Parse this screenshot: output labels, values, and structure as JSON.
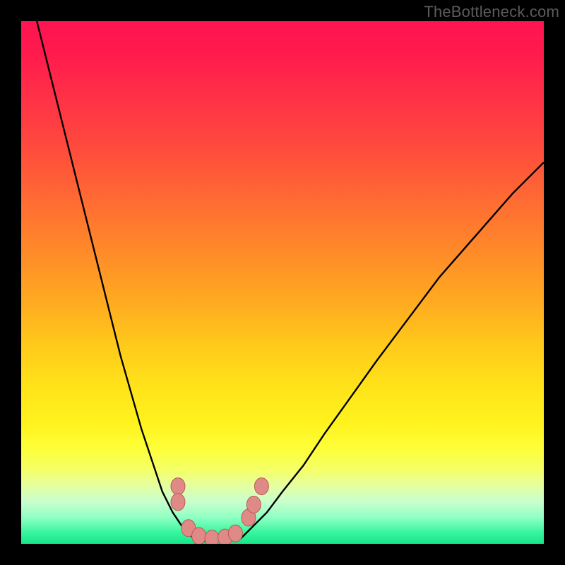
{
  "watermark": "TheBottleneck.com",
  "colors": {
    "curve_stroke": "#000000",
    "marker_fill": "#e08a87",
    "marker_stroke": "#b85a57",
    "background_black": "#000000"
  },
  "chart_data": {
    "type": "line",
    "title": "",
    "xlabel": "",
    "ylabel": "",
    "xlim": [
      0,
      100
    ],
    "ylim": [
      0,
      100
    ],
    "grid": false,
    "legend": false,
    "series": [
      {
        "name": "left-curve",
        "x": [
          3,
          5,
          7,
          9,
          11,
          13,
          15,
          17,
          19,
          21,
          23,
          25,
          27,
          29,
          31,
          33
        ],
        "y": [
          100,
          92,
          84,
          76,
          68,
          60,
          52,
          44,
          36,
          29,
          22,
          16,
          10,
          6,
          3,
          1
        ]
      },
      {
        "name": "right-curve",
        "x": [
          42,
          44,
          47,
          50,
          54,
          58,
          63,
          68,
          74,
          80,
          87,
          94,
          100
        ],
        "y": [
          1,
          3,
          6,
          10,
          15,
          21,
          28,
          35,
          43,
          51,
          59,
          67,
          73
        ]
      },
      {
        "name": "valley-floor",
        "x": [
          33,
          35,
          37,
          39,
          41,
          42
        ],
        "y": [
          1,
          0.5,
          0.5,
          0.5,
          0.8,
          1
        ]
      }
    ],
    "markers": [
      {
        "name": "left-cluster-top",
        "x": 30.0,
        "y": 11
      },
      {
        "name": "left-cluster-bot",
        "x": 30.0,
        "y": 8
      },
      {
        "name": "valley-1",
        "x": 32.0,
        "y": 3
      },
      {
        "name": "valley-2",
        "x": 34.0,
        "y": 1.5
      },
      {
        "name": "valley-3",
        "x": 36.5,
        "y": 1
      },
      {
        "name": "valley-4",
        "x": 39.0,
        "y": 1.2
      },
      {
        "name": "valley-5",
        "x": 41.0,
        "y": 2
      },
      {
        "name": "right-cluster-a",
        "x": 43.5,
        "y": 5
      },
      {
        "name": "right-cluster-b",
        "x": 44.5,
        "y": 7.5
      },
      {
        "name": "right-cluster-c",
        "x": 46.0,
        "y": 11
      }
    ]
  }
}
